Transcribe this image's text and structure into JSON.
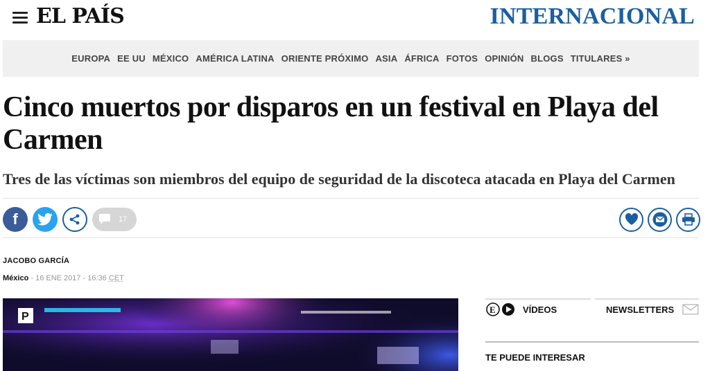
{
  "header": {
    "logo": "EL PAÍS",
    "edition": "INTERNACIONAL"
  },
  "nav": {
    "items": [
      "EUROPA",
      "EE UU",
      "MÉXICO",
      "AMÉRICA LATINA",
      "ORIENTE PRÓXIMO",
      "ASIA",
      "ÁFRICA",
      "FOTOS",
      "OPINIÓN",
      "BLOGS",
      "TITULARES »"
    ]
  },
  "article": {
    "headline": "Cinco muertos por disparos en un festival en Playa del Carmen",
    "subheadline": "Tres de las víctimas son miembros del equipo de seguridad de la discoteca atacada en Playa del Carmen",
    "author": "JACOBO GARCÍA",
    "location": "México",
    "date_sep": " - ",
    "date": "16 ENE 2017 - 16:36",
    "timezone": "CET"
  },
  "share": {
    "facebook_glyph": "f",
    "comment_count": "17"
  },
  "icons": {
    "facebook": "facebook-icon",
    "twitter": "twitter-icon",
    "share": "share-icon",
    "comment": "comment-icon",
    "favorite": "heart-icon",
    "email": "envelope-icon",
    "print": "printer-icon"
  },
  "sidebar": {
    "videos_label": "VÍDEOS",
    "newsletters_label": "NEWSLETTERS",
    "interest_heading": "TE PUEDE INTERESAR"
  },
  "colors": {
    "brand_blue": "#1b5fa0",
    "facebook": "#3b5b99",
    "twitter": "#2aa3ef",
    "nav_bg": "#f0f0f0"
  }
}
